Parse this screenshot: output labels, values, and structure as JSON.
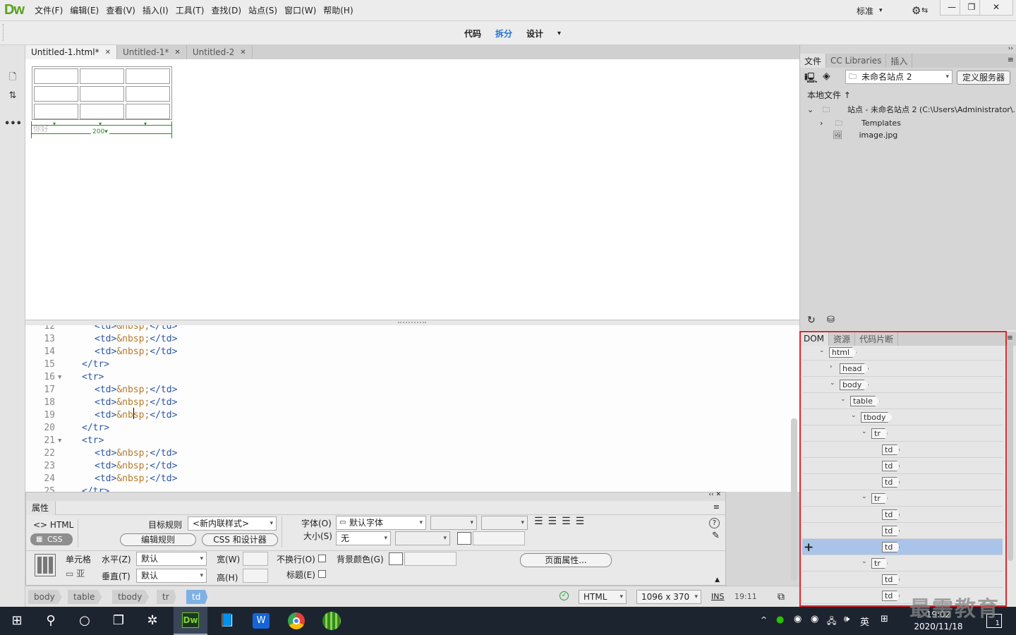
{
  "app": {
    "logo": "Dw"
  },
  "menu": [
    "文件(F)",
    "编辑(E)",
    "查看(V)",
    "插入(I)",
    "工具(T)",
    "查找(D)",
    "站点(S)",
    "窗口(W)",
    "帮助(H)"
  ],
  "workspace": {
    "label": "标准",
    "caret": "▾"
  },
  "window_controls": {
    "minimize": "—",
    "restore": "❐",
    "close": "✕"
  },
  "view_modes": {
    "code": "代码",
    "split": "拆分",
    "design": "设计",
    "more": "▾",
    "active": "split",
    "active_color": "#1f73d3"
  },
  "doc_tabs": [
    {
      "label": "Untitled-1.html*",
      "close": "✕",
      "active": true
    },
    {
      "label": "Untitled-1*",
      "close": "✕",
      "active": false
    },
    {
      "label": "Untitled-2",
      "close": "✕",
      "active": false
    }
  ],
  "design_view": {
    "table": {
      "rows": 3,
      "cols": 3
    },
    "ruler_width": "200",
    "ruler_caret": "▾",
    "ghost_text": "你好"
  },
  "code_lines": [
    {
      "num": "12",
      "fold": "",
      "indent": 4,
      "kind": "td"
    },
    {
      "num": "13",
      "fold": "",
      "indent": 4,
      "kind": "td"
    },
    {
      "num": "14",
      "fold": "",
      "indent": 4,
      "kind": "td"
    },
    {
      "num": "15",
      "fold": "",
      "indent": 3,
      "kind": "trclose"
    },
    {
      "num": "16",
      "fold": "▼",
      "indent": 3,
      "kind": "tropen"
    },
    {
      "num": "17",
      "fold": "",
      "indent": 4,
      "kind": "td"
    },
    {
      "num": "18",
      "fold": "",
      "indent": 4,
      "kind": "td"
    },
    {
      "num": "19",
      "fold": "",
      "indent": 4,
      "kind": "td"
    },
    {
      "num": "20",
      "fold": "",
      "indent": 3,
      "kind": "trclose"
    },
    {
      "num": "21",
      "fold": "▼",
      "indent": 3,
      "kind": "tropen"
    },
    {
      "num": "22",
      "fold": "",
      "indent": 4,
      "kind": "td"
    },
    {
      "num": "23",
      "fold": "",
      "indent": 4,
      "kind": "td"
    },
    {
      "num": "24",
      "fold": "",
      "indent": 4,
      "kind": "td"
    },
    {
      "num": "25",
      "fold": "",
      "indent": 3,
      "kind": "trclose"
    }
  ],
  "code_tokens": {
    "td_open": "<td>",
    "nbsp": "&nbsp;",
    "td_close": "</td>",
    "tr_open": "<tr>",
    "tr_close": "</tr>"
  },
  "properties": {
    "title": "属性",
    "html_label": "<> HTML",
    "css_label": "CSS",
    "target_rule_label": "目标规则",
    "target_rule_value": "<新内联样式>",
    "edit_rule": "编辑规则",
    "css_designer": "CSS 和设计器",
    "font_label": "字体(O)",
    "font_value": "默认字体",
    "size_label": "大小(S)",
    "size_value": "无",
    "cell_label": "单元格",
    "horz_label": "水平(Z)",
    "horz_value": "默认",
    "vert_label": "垂直(T)",
    "vert_value": "默认",
    "width_label": "宽(W)",
    "height_label": "高(H)",
    "nowrap_label": "不换行(O)",
    "header_label": "标题(E)",
    "bgcolor_label": "背景颜色(G)",
    "page_props": "页面属性...",
    "help_icon": "?",
    "collapse_icon": "▲",
    "panel_ctrl": "‹‹  ✕",
    "menu_icon": "≡",
    "dd": "▾"
  },
  "status_bar": {
    "crumbs": [
      "body",
      "table",
      "tbody",
      "tr",
      "td"
    ],
    "active_crumb": "td",
    "ok_icon": "✓",
    "doc_type": "HTML",
    "size": "1096 x 370",
    "mode": "INS",
    "cursor": "19:11",
    "dd": "▾"
  },
  "files_panel": {
    "tabs": [
      "文件",
      "CC Libraries",
      "插入"
    ],
    "site_name": "未命名站点 2",
    "define_server": "定义服务器",
    "local_files": "本地文件",
    "sort_arrow": "↑",
    "tree": [
      {
        "label": "站点 - 未命名站点 2 (C:\\Users\\Administrator\\...",
        "chev": "⌄"
      },
      {
        "label": "Templates",
        "chev": "›"
      },
      {
        "label": "image.jpg",
        "chev": ""
      }
    ],
    "refresh_icon": "↻",
    "menu_icon": "≡",
    "collapse": "››"
  },
  "dom_panel": {
    "tabs": [
      "DOM",
      "资源",
      "代码片断"
    ],
    "menu_icon": "≡",
    "add_icon": "+",
    "border_color": "#e0272c",
    "nodes": [
      {
        "tag": "html",
        "level": 0,
        "chev": "⌄",
        "selected": false
      },
      {
        "tag": "head",
        "level": 1,
        "chev": "›",
        "selected": false
      },
      {
        "tag": "body",
        "level": 1,
        "chev": "⌄",
        "selected": false
      },
      {
        "tag": "table",
        "level": 2,
        "chev": "⌄",
        "selected": false
      },
      {
        "tag": "tbody",
        "level": 3,
        "chev": "⌄",
        "selected": false
      },
      {
        "tag": "tr",
        "level": 4,
        "chev": "⌄",
        "selected": false
      },
      {
        "tag": "td",
        "level": 5,
        "chev": "",
        "selected": false
      },
      {
        "tag": "td",
        "level": 5,
        "chev": "",
        "selected": false
      },
      {
        "tag": "td",
        "level": 5,
        "chev": "",
        "selected": false
      },
      {
        "tag": "tr",
        "level": 4,
        "chev": "⌄",
        "selected": false
      },
      {
        "tag": "td",
        "level": 5,
        "chev": "",
        "selected": false
      },
      {
        "tag": "td",
        "level": 5,
        "chev": "",
        "selected": false
      },
      {
        "tag": "td",
        "level": 5,
        "chev": "",
        "selected": true
      },
      {
        "tag": "tr",
        "level": 4,
        "chev": "⌄",
        "selected": false
      },
      {
        "tag": "td",
        "level": 5,
        "chev": "",
        "selected": false
      },
      {
        "tag": "td",
        "level": 5,
        "chev": "",
        "selected": false
      }
    ]
  },
  "taskbar": {
    "icons": [
      "windows-start",
      "search",
      "cortana",
      "task-view",
      "pinwheel-app",
      "dreamweaver",
      "notepad",
      "wps",
      "chrome",
      "watermelon-app"
    ],
    "dw_label": "Dw",
    "ime": "英",
    "tray_chevron": "^",
    "speaker": "🕪",
    "clock_time": "19:02",
    "clock_date": "2020/11/18",
    "notification_count": "1"
  },
  "watermark": "最需教育"
}
